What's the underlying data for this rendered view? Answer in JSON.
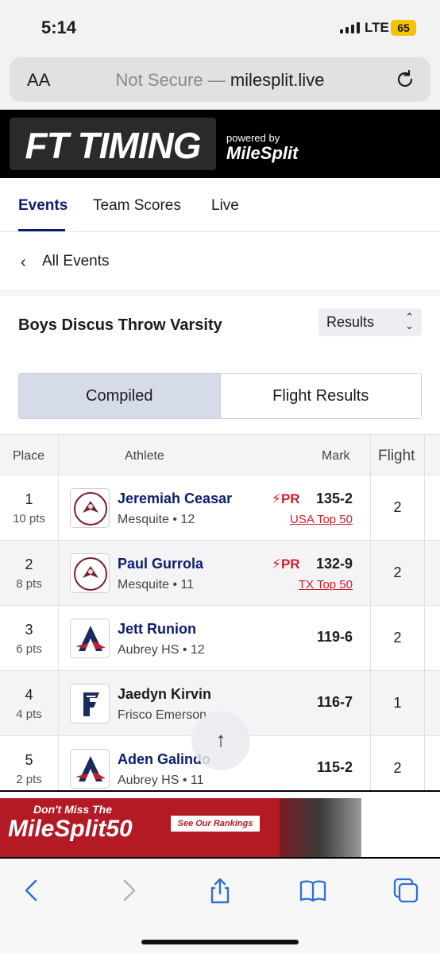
{
  "status": {
    "time": "5:14",
    "network": "LTE",
    "battery": "65"
  },
  "browser": {
    "text_size": "AA",
    "not_secure": "Not Secure",
    "separator": " — ",
    "domain": "milesplit.live"
  },
  "brand": {
    "logo_text": "FT TIMING",
    "powered_by": "powered by",
    "partner": "MileSplit"
  },
  "nav": {
    "tabs": [
      {
        "label": "Events"
      },
      {
        "label": "Team Scores"
      },
      {
        "label": "Live"
      }
    ],
    "active": "Events"
  },
  "back_link": {
    "label": "All Events"
  },
  "event": {
    "title": "Boys Discus Throw Varsity",
    "view_select": "Results"
  },
  "segments": {
    "compiled": "Compiled",
    "flight": "Flight Results",
    "active": "Compiled"
  },
  "table": {
    "headers": {
      "place": "Place",
      "athlete": "Athlete",
      "mark": "Mark",
      "flight": "Flight"
    },
    "rows": [
      {
        "place": "1",
        "pts": "10 pts",
        "name": "Jeremiah Ceasar",
        "team": "Mesquite • 12",
        "pr": "PR",
        "mark": "135-2",
        "rank": "USA Top 50",
        "flight": "2"
      },
      {
        "place": "2",
        "pts": "8 pts",
        "name": "Paul Gurrola",
        "team": "Mesquite • 11",
        "pr": "PR",
        "mark": "132-9",
        "rank": "TX Top 50",
        "flight": "2"
      },
      {
        "place": "3",
        "pts": "6 pts",
        "name": "Jett Runion",
        "team": "Aubrey HS • 12",
        "pr": "",
        "mark": "119-6",
        "rank": "",
        "flight": "2"
      },
      {
        "place": "4",
        "pts": "4 pts",
        "name": "Jaedyn Kirvin",
        "team": "Frisco Emerson",
        "pr": "",
        "mark": "116-7",
        "rank": "",
        "flight": "1"
      },
      {
        "place": "5",
        "pts": "2 pts",
        "name": "Aden Galindo",
        "team": "Aubrey HS • 11",
        "pr": "",
        "mark": "115-2",
        "rank": "",
        "flight": "2"
      }
    ]
  },
  "ad": {
    "line1": "Don't Miss The",
    "line2": "MileSplit50",
    "cta": "See Our Rankings"
  },
  "colors": {
    "brand_navy": "#0c1d6e",
    "pr_red": "#d0202c",
    "row_shade": "#f4f4f6"
  }
}
